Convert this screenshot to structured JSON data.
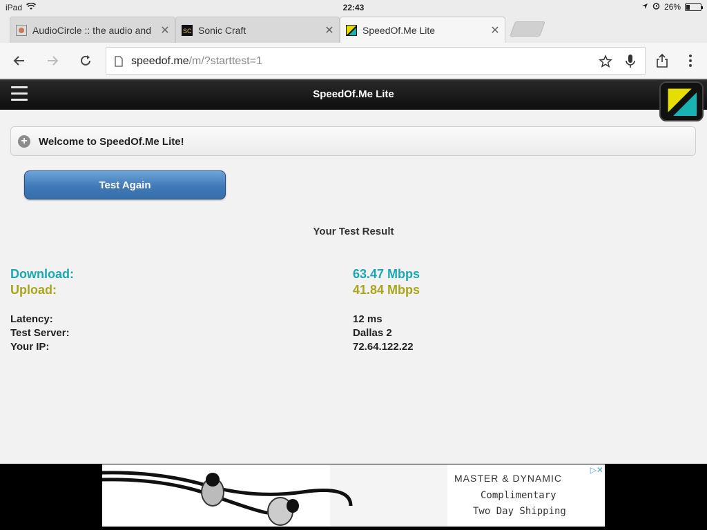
{
  "status_bar": {
    "device": "iPad",
    "time": "22:43",
    "battery_percent": "26%",
    "battery_level": 0.26
  },
  "tabs": [
    {
      "title": "AudioCircle :: the audio and",
      "active": false
    },
    {
      "title": "Sonic Craft",
      "active": false
    },
    {
      "title": "SpeedOf.Me Lite",
      "active": true
    }
  ],
  "toolbar": {
    "url_host": "speedof.me",
    "url_path": "/m/?starttest=1"
  },
  "header": {
    "title": "SpeedOf.Me Lite"
  },
  "welcome": {
    "text": "Welcome to SpeedOf.Me Lite!"
  },
  "test_again_label": "Test Again",
  "results": {
    "heading": "Your Test Result",
    "download": {
      "label": "Download:",
      "value": "63.47 Mbps",
      "color": "#1aa8b2"
    },
    "upload": {
      "label": "Upload:",
      "value": "41.84 Mbps",
      "color": "#a9a51c"
    },
    "latency": {
      "label": "Latency:",
      "value": "12 ms"
    },
    "server": {
      "label": "Test Server:",
      "value": "Dallas 2"
    },
    "ip": {
      "label": "Your IP:",
      "value": "72.64.122.22"
    }
  },
  "ad": {
    "brand": "MASTER & DYNAMIC",
    "line1": "Complimentary",
    "line2": "Two Day Shipping"
  },
  "colors": {
    "header_bg": "#111111",
    "button_blue": "#3f79b8",
    "logo_yellow": "#e6de00",
    "logo_teal": "#19b3b3"
  }
}
